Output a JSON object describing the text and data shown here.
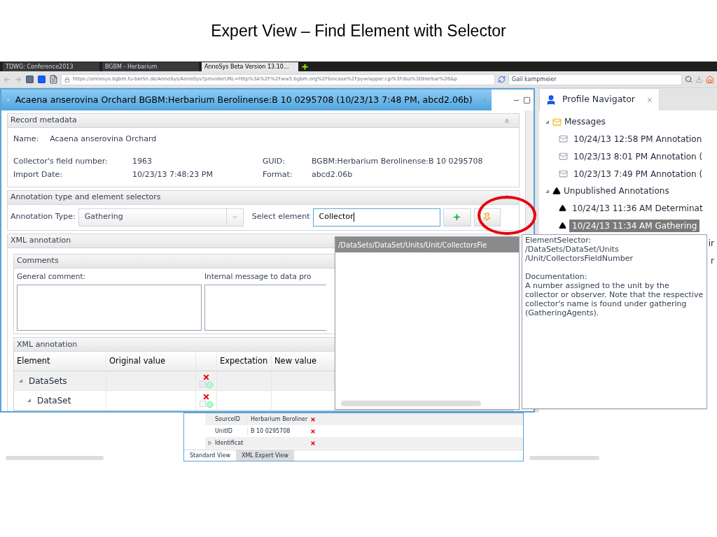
{
  "slide_title": "Expert View – Find Element with Selector",
  "browser": {
    "tabs": [
      {
        "label": "TDWG: Conference2013",
        "selected": false
      },
      {
        "label": "BGBM - Herbarium",
        "selected": false
      },
      {
        "label": "AnnoSys Beta Version 13.10...",
        "selected": true
      }
    ],
    "url": "https://annosys.bgbm.fu-berlin.de/AnnoSys/AnnoSys?providerURL=http%3A%2F%2Fww3.bgbm.org%2Fbiocase%2Fpywrapper.cgi%3Fdsa%3DHerbar%26&p",
    "search": "Gail kampmeier"
  },
  "editor": {
    "title": "Acaena anserovina Orchard BGBM:Herbarium Berolinense:B 10 0295708 (10/23/13 7:48 PM, abcd2.06b)",
    "record": {
      "header": "Record metadata",
      "name_label": "Name:",
      "name": "Acaena anserovina Orchard",
      "fields": [
        {
          "label": "Collector's field number:",
          "value": "1963",
          "label2": "GUID:",
          "value2": "BGBM:Herbarium Berolinense:B 10 0295708"
        },
        {
          "label": "Import Date:",
          "value": "10/23/13 7:48:23 PM",
          "label2": "Format:",
          "value2": "abcd2.06b"
        }
      ]
    },
    "selectors": {
      "header": "Annotation type and element selectors",
      "type_label": "Annotation Type:",
      "type_value": "Gathering",
      "element_label": "Select element",
      "element_value": "Collector"
    },
    "xml": {
      "header": "XML annotation",
      "comments_header": "Comments",
      "general_label": "General comment:",
      "internal_label": "Internal message to data pro",
      "table_header": "XML annotation",
      "columns": [
        "Element",
        "Original value",
        "Expectation",
        "New value"
      ],
      "rows": [
        {
          "element": "DataSets",
          "expanded": true,
          "children": [
            {
              "element": "DataSet",
              "expanded": true
            }
          ]
        }
      ]
    },
    "dropdown": {
      "items": [
        {
          "label": "/DataSets/DataSet/Units/Unit/CollectorsFie",
          "selected": true
        }
      ]
    },
    "tooltip": {
      "lines": [
        "ElementSelector:",
        "/DataSets/DataSet/Units",
        "/Unit/CollectorsFieldNumber"
      ],
      "doc_title": "Documentation:",
      "doc": "A number assigned to the unit by the collector or observer. Note that the respective collector's name is found under gathering (GatheringAgents)."
    }
  },
  "lower": {
    "rows": [
      {
        "element": "SourceID",
        "original": "Herbarium Beroliner",
        "expandable": false
      },
      {
        "element": "UnitID",
        "original": "B 10 0295708",
        "expandable": false
      },
      {
        "element": "Identificat",
        "original": "",
        "expandable": true
      }
    ],
    "tabs": [
      {
        "label": "Standard View",
        "selected": false
      },
      {
        "label": "XML Expert View",
        "selected": true
      }
    ]
  },
  "navigator": {
    "title": "Profile Navigator",
    "groups": [
      {
        "label": "Messages",
        "kind": "messages",
        "expanded": true,
        "items": [
          {
            "label": "10/24/13 12:58 PM Annotation",
            "selected": false
          },
          {
            "label": "10/23/13 8:01 PM Annotation (",
            "selected": false
          },
          {
            "label": "10/23/13 7:49 PM Annotation (",
            "selected": false
          }
        ]
      },
      {
        "label": "Unpublished Annotations",
        "kind": "annotations",
        "expanded": true,
        "items": [
          {
            "label": "10/24/13 11:36 AM Determinat",
            "selected": false
          },
          {
            "label": "10/24/13 11:34 AM Gathering",
            "selected": true
          },
          {
            "label": "ir",
            "selected": false
          },
          {
            "label": "r",
            "selected": false
          }
        ]
      }
    ]
  }
}
